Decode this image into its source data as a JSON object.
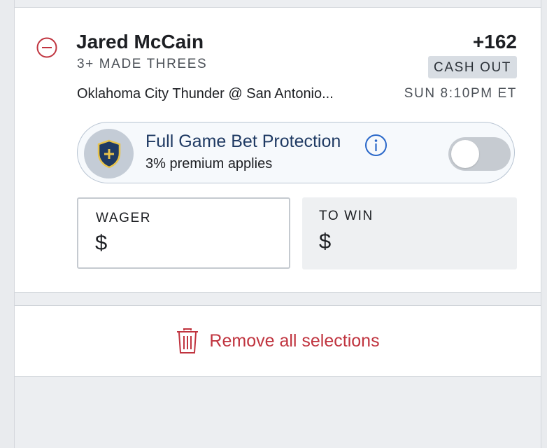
{
  "selection": {
    "player": "Jared McCain",
    "market": "3+ MADE THREES",
    "odds": "+162",
    "cash_out": "CASH OUT",
    "matchup": "Oklahoma City Thunder @ San Antonio...",
    "game_time": "SUN 8:10PM ET",
    "remove_icon": "minus-circle-icon"
  },
  "protection": {
    "title": "Full Game Bet Protection",
    "subtitle": "3% premium applies",
    "icon": "shield-plus-icon",
    "info_icon": "info-icon",
    "enabled": false
  },
  "wager": {
    "label": "WAGER",
    "currency": "$",
    "value": ""
  },
  "to_win": {
    "label": "TO WIN",
    "currency": "$",
    "value": ""
  },
  "footer": {
    "remove_all_label": "Remove all selections",
    "icon": "trash-icon"
  },
  "colors": {
    "accent_red": "#c0343f",
    "brand_navy": "#1f3a63",
    "info_blue": "#2a68c9",
    "shield_gold": "#e8c34a"
  }
}
